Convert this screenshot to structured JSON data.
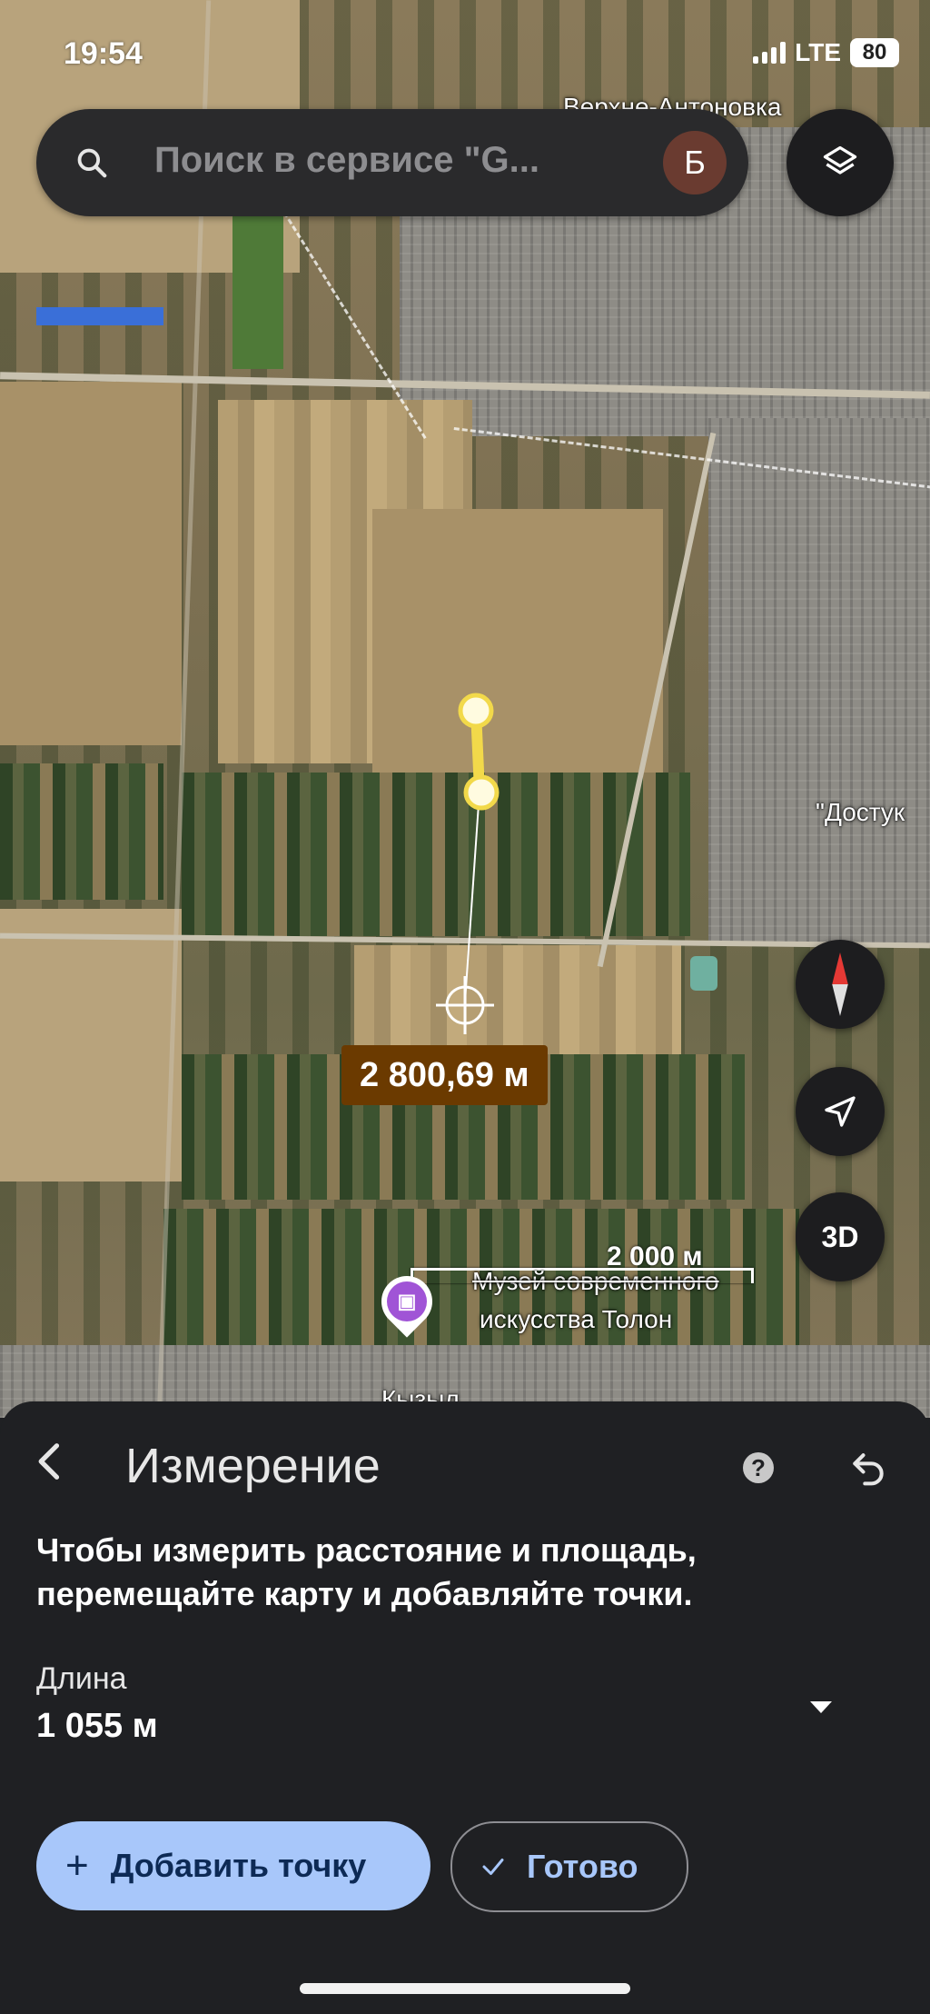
{
  "status_bar": {
    "time": "19:54",
    "network": "LTE",
    "battery": "80"
  },
  "search": {
    "placeholder": "Поиск в сервисе \"G...",
    "avatar_letter": "Б"
  },
  "map": {
    "labels": {
      "top": "Верхне-Антоновка",
      "right": "\"Достук",
      "bottom": "Кызыл"
    },
    "distance_badge": "2 800,69 м",
    "scale_label": "2 000 м",
    "poi": {
      "line1": "Музей современного",
      "line2": "искусства Толон",
      "icon": "museum-icon"
    },
    "buttons": {
      "layers": "layers-icon",
      "compass": "compass-icon",
      "navigate": "navigation-arrow-icon",
      "three_d": "3D"
    }
  },
  "sheet": {
    "title": "Измерение",
    "help": "?",
    "instruction": "Чтобы измерить расстояние и площадь, перемещайте карту и добавляйте точки.",
    "length_label": "Длина",
    "length_value": "1 055 м",
    "add_point": "Добавить точку",
    "done": "Готово"
  },
  "colors": {
    "accent": "#a8c7fa",
    "badge": "#6b3a00",
    "measure_line": "#f2d94a",
    "sheet_bg": "#1f2023"
  }
}
